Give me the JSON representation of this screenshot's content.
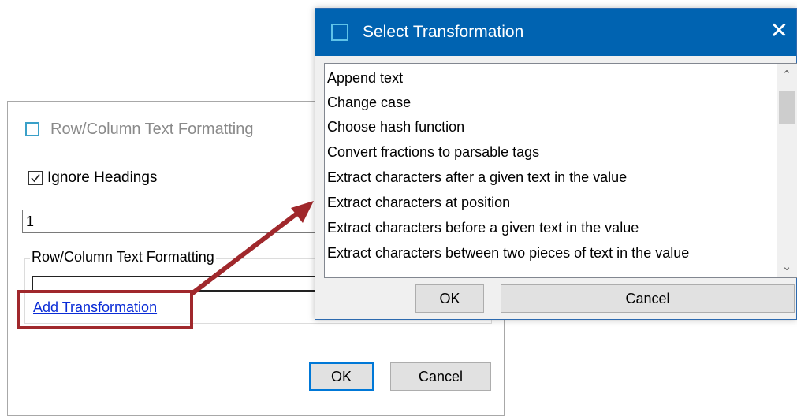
{
  "back_dialog": {
    "title": "Row/Column Text Formatting",
    "ignore_headings_label": "Ignore Headings",
    "ignore_headings_checked": true,
    "input_value": "1",
    "group_title": "Row/Column Text Formatting",
    "add_transformation_label": "Add Transformation",
    "ok_label": "OK",
    "cancel_label": "Cancel"
  },
  "select_dialog": {
    "title": "Select Transformation",
    "close_glyph": "✕",
    "items": [
      "Append text",
      "Change case",
      "Choose hash function",
      "Convert fractions to parsable tags",
      "Extract characters after a given text in the value",
      "Extract characters at position",
      "Extract characters before a given text in the value",
      "Extract characters between two pieces of text in the value"
    ],
    "ok_label": "OK",
    "cancel_label": "Cancel"
  },
  "colors": {
    "titlebar": "#0063b1",
    "highlight": "#a0282c",
    "link": "#0a2bd6",
    "default_button_border": "#0078d7"
  }
}
